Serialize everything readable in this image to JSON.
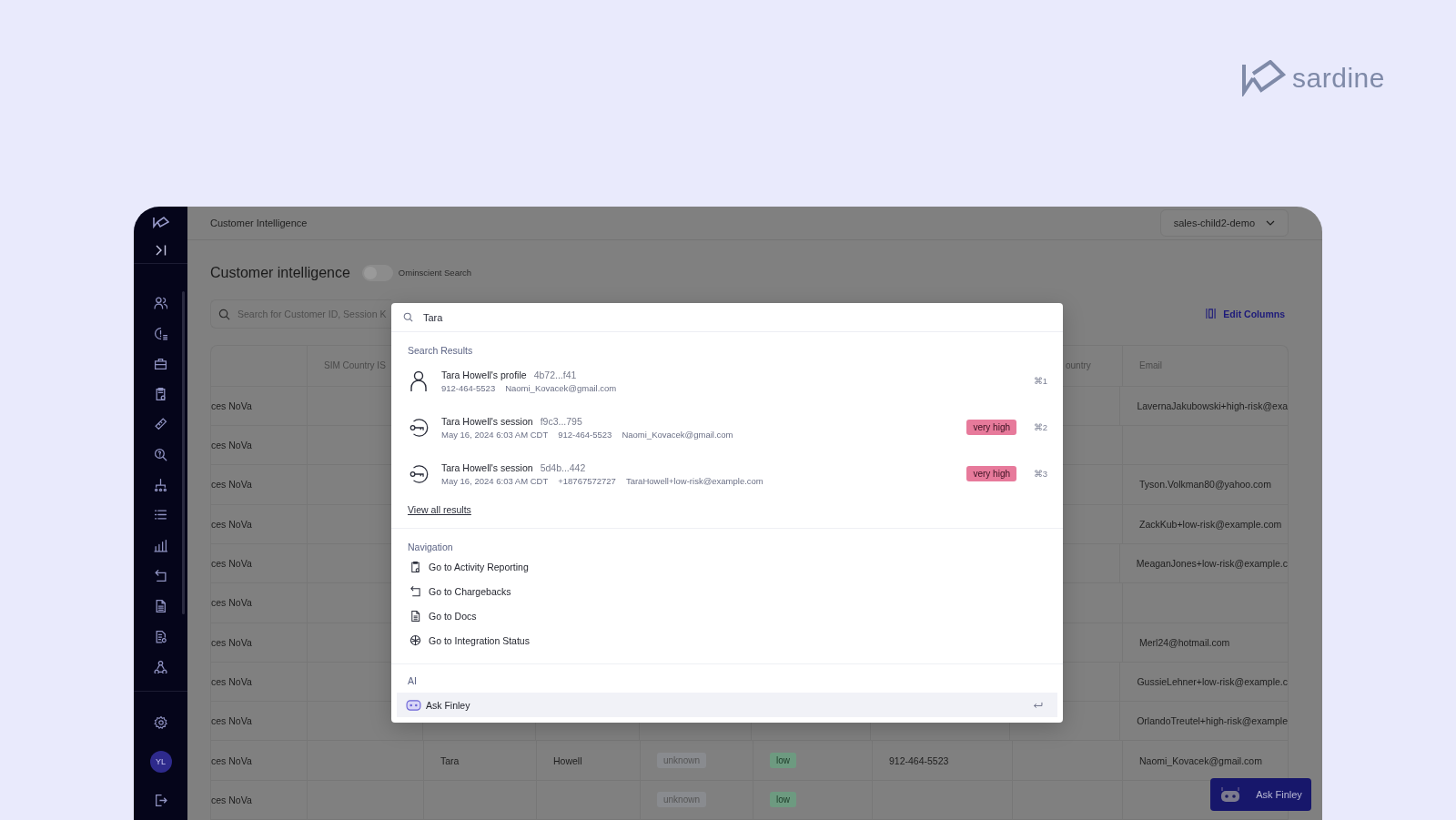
{
  "logo": {
    "text": "sardine"
  },
  "header": {
    "breadcrumb": "Customer Intelligence",
    "org_selector": "sales-child2-demo"
  },
  "sidebar": {
    "avatar": "YL"
  },
  "page": {
    "title": "Customer intelligence",
    "toggle": {
      "label": "Ominscient Search",
      "on": false
    },
    "search": {
      "placeholder": "Search for Customer ID, Session K"
    },
    "edit_columns": "Edit Columns"
  },
  "table": {
    "columns": [
      {},
      {
        "label": "SIM Country IS"
      },
      {},
      {},
      {
        "kind": "status_tag"
      },
      {
        "kind": "risk_tag"
      },
      {},
      {
        "label": "ountry"
      },
      {
        "label": "Email"
      }
    ],
    "rows": [
      {
        "column_1": "ces NoVa",
        "column_9": "LavernaJakubowski+high-risk@exa"
      },
      {
        "column_1": "ces NoVa"
      },
      {
        "column_1": "ces NoVa",
        "column_9": "Tyson.Volkman80@yahoo.com"
      },
      {
        "column_1": "ces NoVa",
        "column_9": "ZackKub+low-risk@example.com"
      },
      {
        "column_1": "ces NoVa",
        "column_9": "MeaganJones+low-risk@example.c"
      },
      {
        "column_1": "ces NoVa"
      },
      {
        "column_1": "ces NoVa",
        "column_9": "Merl24@hotmail.com"
      },
      {
        "column_1": "ces NoVa",
        "column_9": "GussieLehner+low-risk@example.c"
      },
      {
        "column_1": "ces NoVa",
        "column_9": "OrlandoTreutel+high-risk@example"
      },
      {
        "column_1": "ces NoVa",
        "column_3": "Tara",
        "column_4": "Howell",
        "column_5": "unknown",
        "column_6": "low",
        "column_7": "912-464-5523",
        "column_9": "Naomi_Kovacek@gmail.com"
      },
      {
        "column_1": "ces NoVa",
        "column_5": "unknown",
        "column_6": "low"
      }
    ]
  },
  "command_palette": {
    "query": "Tara",
    "search_results": {
      "title": "Search Results",
      "items": [
        {
          "kind": "profile",
          "title": "Tara Howell's profile",
          "id": "4b72...f41",
          "details": [
            "912-464-5523",
            "Naomi_Kovacek@gmail.com"
          ],
          "shortcut": "⌘1"
        },
        {
          "kind": "session",
          "title": "Tara Howell's session",
          "id": "f9c3...795",
          "details": [
            "May 16, 2024 6:03 AM CDT",
            "912-464-5523",
            "Naomi_Kovacek@gmail.com"
          ],
          "risk": "very high",
          "shortcut": "⌘2"
        },
        {
          "kind": "session",
          "title": "Tara Howell's session",
          "id": "5d4b...442",
          "details": [
            "May 16, 2024 6:03 AM CDT",
            "+18767572727",
            "TaraHowell+low-risk@example.com"
          ],
          "risk": "very high",
          "shortcut": "⌘3"
        }
      ],
      "view_all": "View all results"
    },
    "navigation": {
      "title": "Navigation",
      "items": [
        {
          "kind": "activity",
          "label": "Go to Activity Reporting"
        },
        {
          "kind": "chargebacks",
          "label": "Go to Chargebacks"
        },
        {
          "kind": "docs",
          "label": "Go to Docs"
        },
        {
          "kind": "integration",
          "label": "Go to Integration Status"
        }
      ]
    },
    "ai": {
      "title": "AI",
      "items": [
        {
          "label": "Ask Finley",
          "selected": true
        }
      ]
    }
  },
  "finley_button": {
    "label": "Ask Finley"
  }
}
